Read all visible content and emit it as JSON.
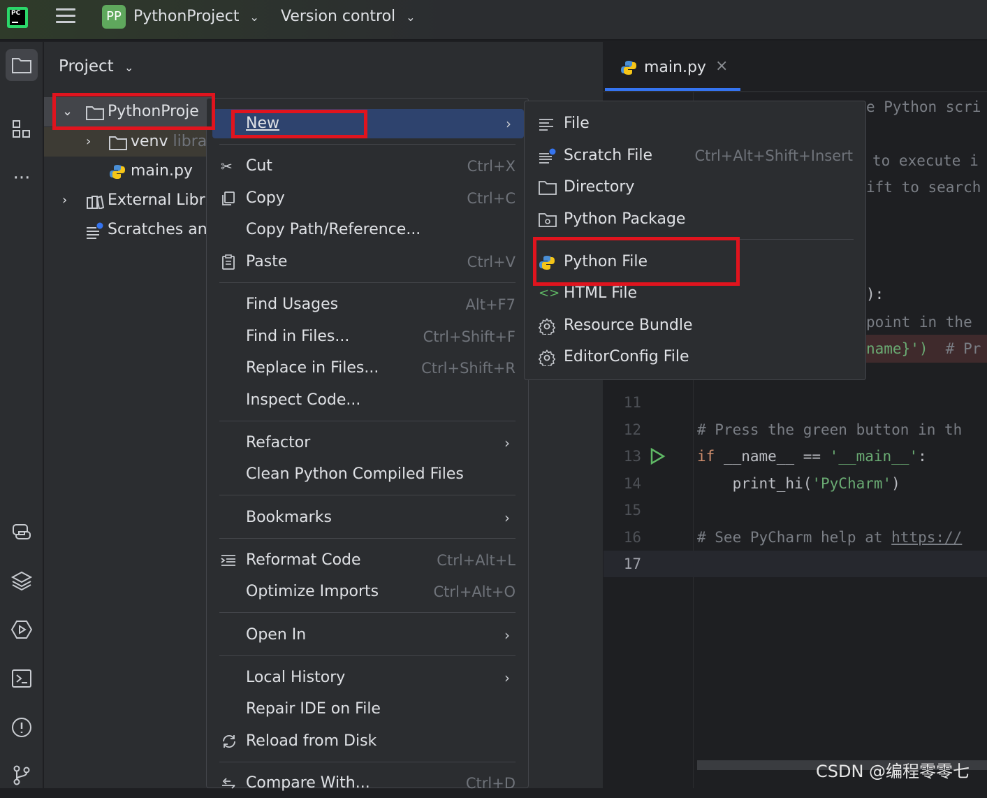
{
  "titlebar": {
    "project_badge": "PP",
    "project_name": "PythonProject",
    "vcs": "Version control"
  },
  "project_panel": {
    "title": "Project",
    "tree": [
      {
        "label": "PythonProje"
      },
      {
        "label": "venv",
        "suffix": "libra"
      },
      {
        "label": "main.py"
      },
      {
        "label": "External Libra"
      },
      {
        "label": "Scratches an"
      }
    ]
  },
  "editor": {
    "tab": "main.py",
    "line_numbers": [
      "11",
      "12",
      "13",
      "14",
      "15",
      "16",
      "17"
    ],
    "fragments": {
      "f1": "e Python scri",
      "f2": "to execute i",
      "f3": "ift to search",
      "f4": "):",
      "f5": "point in the",
      "f6a": "name}')",
      "f6b": "  # Pr"
    },
    "code": {
      "l12": "# Press the green button in th",
      "l13_kw": "if",
      "l13_mid": " __name__ == ",
      "l13_str": "'__main__'",
      "l13_end": ":",
      "l14_a": "    print_hi(",
      "l14_str": "'PyCharm'",
      "l14_b": ")",
      "l16_cmt": "# See PyCharm help at ",
      "l16_link": "https://"
    }
  },
  "context_menu": {
    "items": [
      {
        "label": "New"
      },
      {
        "label": "Cut",
        "shortcut": "Ctrl+X"
      },
      {
        "label": "Copy",
        "shortcut": "Ctrl+C"
      },
      {
        "label": "Copy Path/Reference..."
      },
      {
        "label": "Paste",
        "shortcut": "Ctrl+V"
      },
      {
        "label": "Find Usages",
        "shortcut": "Alt+F7"
      },
      {
        "label": "Find in Files...",
        "shortcut": "Ctrl+Shift+F"
      },
      {
        "label": "Replace in Files...",
        "shortcut": "Ctrl+Shift+R"
      },
      {
        "label": "Inspect Code..."
      },
      {
        "label": "Refactor"
      },
      {
        "label": "Clean Python Compiled Files"
      },
      {
        "label": "Bookmarks"
      },
      {
        "label": "Reformat Code",
        "shortcut": "Ctrl+Alt+L"
      },
      {
        "label": "Optimize Imports",
        "shortcut": "Ctrl+Alt+O"
      },
      {
        "label": "Open In"
      },
      {
        "label": "Local History"
      },
      {
        "label": "Repair IDE on File"
      },
      {
        "label": "Reload from Disk"
      },
      {
        "label": "Compare With...",
        "shortcut": "Ctrl+D"
      }
    ]
  },
  "submenu": {
    "items": [
      {
        "label": "File"
      },
      {
        "label": "Scratch File",
        "shortcut": "Ctrl+Alt+Shift+Insert"
      },
      {
        "label": "Directory"
      },
      {
        "label": "Python Package"
      },
      {
        "label": "Python File"
      },
      {
        "label": "HTML File"
      },
      {
        "label": "Resource Bundle"
      },
      {
        "label": "EditorConfig File"
      }
    ]
  },
  "watermark": "CSDN @编程零零七",
  "colors": {
    "highlight_box": "#e0141e",
    "selection": "#2e436e",
    "background": "#2b2d30"
  }
}
